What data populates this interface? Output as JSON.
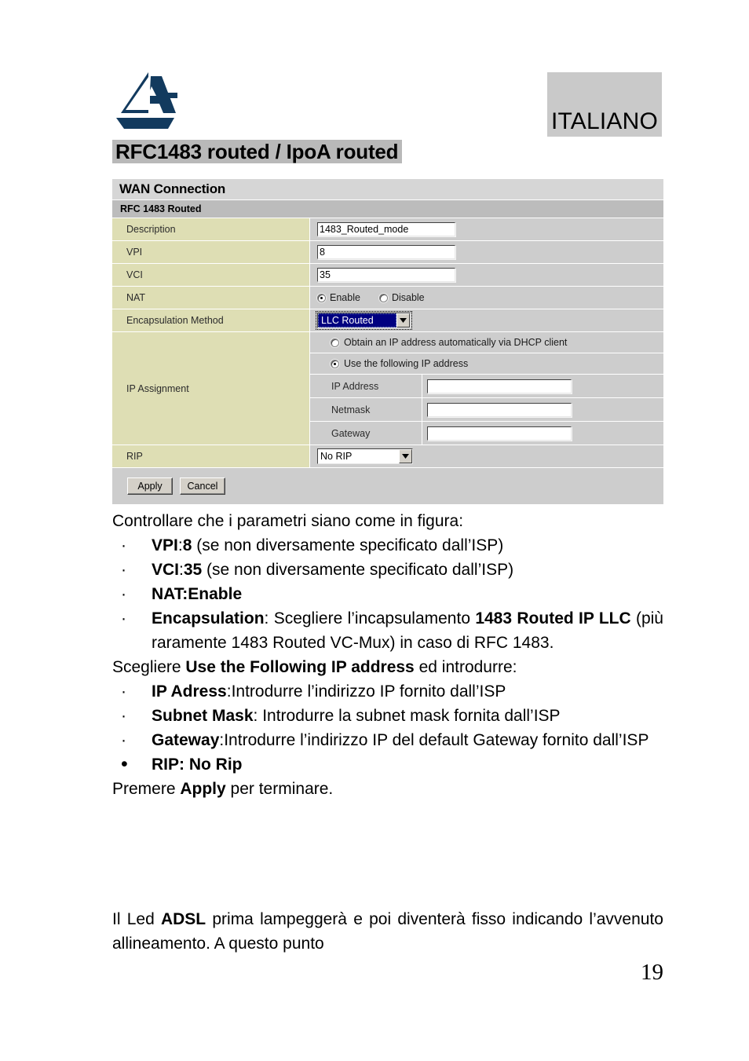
{
  "header": {
    "logo_icon": "atlantis-land-logo",
    "language_badge": "ITALIANO",
    "doc_title": "RFC1483 routed / IpoA routed"
  },
  "router_panel": {
    "title": "WAN Connection",
    "section": "RFC 1483 Routed",
    "fields": {
      "description_label": "Description",
      "description_value": "1483_Routed_mode",
      "vpi_label": "VPI",
      "vpi_value": "8",
      "vci_label": "VCI",
      "vci_value": "35",
      "nat_label": "NAT",
      "nat_enable_label": "Enable",
      "nat_disable_label": "Disable",
      "encapsulation_label": "Encapsulation Method",
      "encapsulation_value": "LLC Routed",
      "ip_assignment_label": "IP Assignment",
      "ip_dhcp_option": "Obtain an IP address automatically via DHCP client",
      "ip_static_option": "Use the following IP address",
      "ip_address_label": "IP Address",
      "ip_address_value": "",
      "netmask_label": "Netmask",
      "netmask_value": "",
      "gateway_label": "Gateway",
      "gateway_value": "",
      "rip_label": "RIP",
      "rip_value": "No RIP"
    },
    "buttons": {
      "apply": "Apply",
      "cancel": "Cancel"
    },
    "colors": {
      "label_column": "#dedeb4",
      "value_column": "#cdcdcd",
      "panel_title_bar": "#d6d6d6",
      "section_bar": "#bcbcbc",
      "select_focus_bg": "#000080",
      "badge_bg": "#c9c9c9",
      "title_highlight": "#b9b9b9"
    }
  },
  "instructions": {
    "intro": "Controllare che i parametri siano come in figura:",
    "bullets": [
      {
        "bold_lead": "VPI",
        "rest_plain": ":",
        "bold_value": "8",
        "tail": " (se non diversamente specificato dall’ISP)"
      },
      {
        "bold_lead": "VCI",
        "rest_plain": ":",
        "bold_value": "35",
        "tail": " (se non diversamente specificato dall’ISP)"
      },
      {
        "bold_lead": "NAT:Enable",
        "rest_plain": "",
        "bold_value": "",
        "tail": ""
      }
    ],
    "encapsulation_bullet": {
      "bold_lead": "Encapsulation",
      "mid": ": Scegliere l’incapsulamento ",
      "bold_value": "1483 Routed IP LLC",
      "tail": " (più raramente 1483 Routed VC-Mux) in caso di RFC 1483."
    },
    "choose_line_pre": "Scegliere ",
    "choose_line_bold": "Use the Following IP address",
    "choose_line_post": " ed introdurre:",
    "ip_bullets": [
      {
        "bold_lead": "IP Adress",
        "tail": ":Introdurre l’indirizzo IP fornito dall’ISP"
      },
      {
        "bold_lead": "Subnet Mask",
        "tail": ": Introdurre la subnet mask fornita dall’ISP"
      },
      {
        "bold_lead": "Gateway",
        "tail": ":Introdurre l’indirizzo IP del default Gateway fornito dall’ISP"
      }
    ],
    "rip_bullet": "RIP: No Rip",
    "apply_line_pre": "Premere ",
    "apply_line_bold": "Apply",
    "apply_line_post": " per terminare."
  },
  "tail_paragraph": {
    "pre": "Il Led ",
    "bold": "ADSL",
    "post": " prima lampeggerà e poi diventerà fisso indicando l’avvenuto allineamento. A questo punto"
  },
  "page_number": "19"
}
